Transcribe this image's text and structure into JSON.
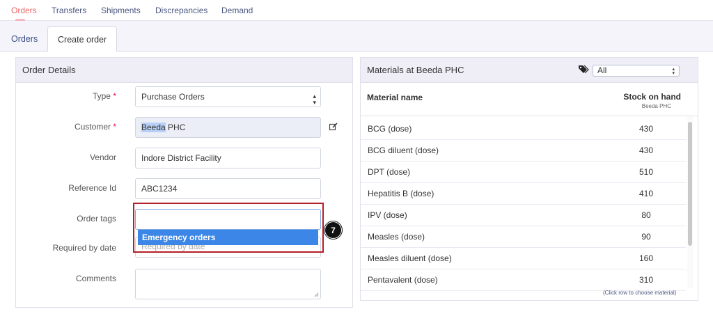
{
  "topnav": {
    "items": [
      "Orders",
      "Transfers",
      "Shipments",
      "Discrepancies",
      "Demand"
    ]
  },
  "subtabs": [
    "Orders",
    "Create order"
  ],
  "order_details": {
    "title": "Order Details",
    "type_label": "Type",
    "type_value": "Purchase Orders",
    "customer_label": "Customer",
    "customer_value_highlight": "Beeda",
    "customer_value_rest": " PHC",
    "vendor_label": "Vendor",
    "vendor_value": "Indore District Facility",
    "reference_label": "Reference Id",
    "reference_value": "ABC1234",
    "tags_label": "Order tags",
    "tags_option": "Emergency orders",
    "required_label": "Required by date",
    "required_placeholder": "Required by date",
    "comments_label": "Comments",
    "required_mark": "*"
  },
  "materials": {
    "title": "Materials at Beeda PHC",
    "filter_value": "All",
    "col_name": "Material name",
    "col_stock": "Stock on hand",
    "col_stock_sub": "Beeda PHC",
    "rows": [
      {
        "name": "BCG (dose)",
        "stock": "430"
      },
      {
        "name": "BCG diluent (dose)",
        "stock": "430"
      },
      {
        "name": "DPT (dose)",
        "stock": "510"
      },
      {
        "name": "Hepatitis B (dose)",
        "stock": "410"
      },
      {
        "name": "IPV (dose)",
        "stock": "80"
      },
      {
        "name": "Measles (dose)",
        "stock": "90"
      },
      {
        "name": "Measles diluent (dose)",
        "stock": "160"
      },
      {
        "name": "Pentavalent (dose)",
        "stock": "310"
      }
    ],
    "hint": "(Click row to choose material)"
  },
  "annotation": {
    "step": "7"
  },
  "colors": {
    "accent": "#4a90e2",
    "highlight_box": "#b3202a",
    "active_nav": "#ee6666"
  }
}
